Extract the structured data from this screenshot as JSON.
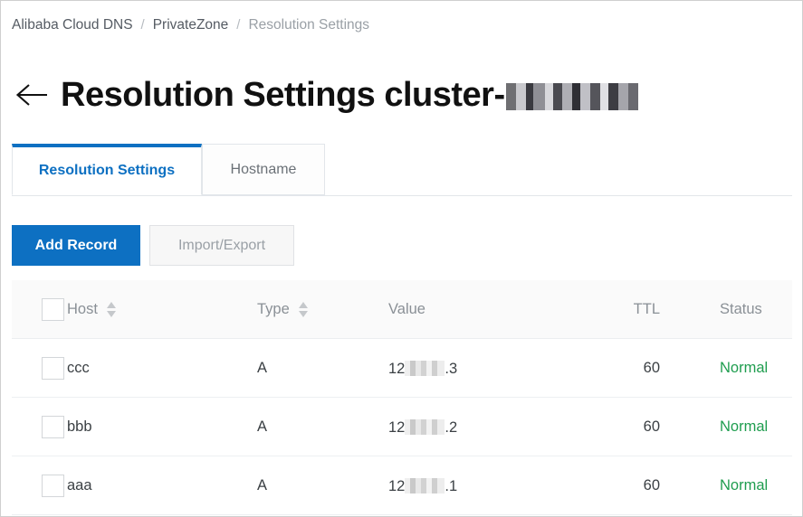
{
  "breadcrumb": {
    "items": [
      {
        "label": "Alibaba Cloud DNS",
        "muted": false
      },
      {
        "label": "PrivateZone",
        "muted": false
      },
      {
        "label": "Resolution Settings",
        "muted": true
      }
    ],
    "separator": "/"
  },
  "header": {
    "back_icon": "arrow-left-icon",
    "title_prefix": "Resolution Settings cluster-",
    "title_redacted": true
  },
  "tabs": [
    {
      "label": "Resolution Settings",
      "active": true
    },
    {
      "label": "Hostname",
      "active": false
    }
  ],
  "toolbar": {
    "add_record_label": "Add Record",
    "import_export_label": "Import/Export"
  },
  "table": {
    "columns": [
      {
        "key": "check",
        "label": "",
        "sortable": false
      },
      {
        "key": "host",
        "label": "Host",
        "sortable": true
      },
      {
        "key": "type",
        "label": "Type",
        "sortable": true
      },
      {
        "key": "value",
        "label": "Value",
        "sortable": false
      },
      {
        "key": "ttl",
        "label": "TTL",
        "sortable": false
      },
      {
        "key": "status",
        "label": "Status",
        "sortable": false
      }
    ],
    "rows": [
      {
        "host": "ccc",
        "type": "A",
        "value_prefix": "12",
        "value_suffix": ".3",
        "value_redacted": true,
        "ttl": "60",
        "status": "Normal"
      },
      {
        "host": "bbb",
        "type": "A",
        "value_prefix": "12",
        "value_suffix": ".2",
        "value_redacted": true,
        "ttl": "60",
        "status": "Normal"
      },
      {
        "host": "aaa",
        "type": "A",
        "value_prefix": "12",
        "value_suffix": ".1",
        "value_redacted": true,
        "ttl": "60",
        "status": "Normal"
      }
    ]
  },
  "colors": {
    "accent_blue": "#0d70c2",
    "status_green": "#1f9d4f",
    "muted_text": "#9aa0a6",
    "header_bg": "#fafafa",
    "border": "#e2e6ea"
  }
}
